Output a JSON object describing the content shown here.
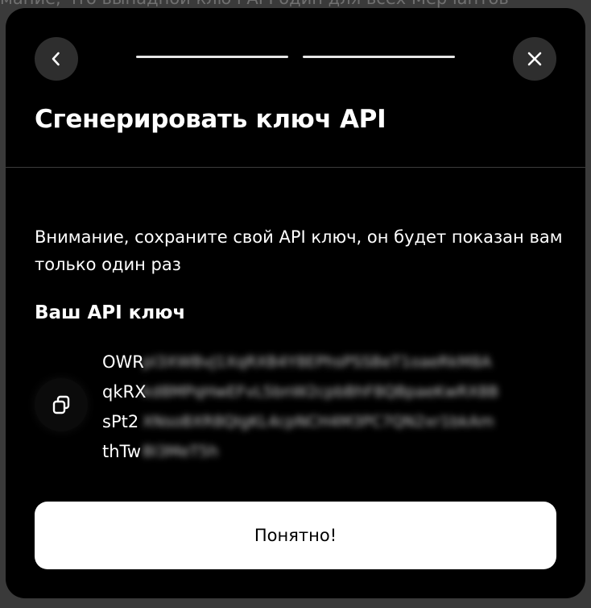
{
  "backdrop": {
    "text": "мание, что выпадной ключ API один для всех Мерчантов"
  },
  "modal": {
    "title": "Сгенерировать ключ API",
    "progress_steps": 2,
    "back_icon": "chevron-left-icon",
    "close_icon": "close-icon",
    "warning": "Внимание, сохраните свой API ключ, он будет показан вам только один раз",
    "key_heading": "Ваш API ключ",
    "copy_icon": "copy-icon",
    "key_lines": [
      {
        "visible": "OWR",
        "hidden": "pl3XWBvJ1XqRXB4Y8EPhsPSSBeT1oaeRkM8A"
      },
      {
        "visible": "qkRX",
        "hidden": "kd8MPqHwEFvL5bnW2cpbBhF8QBpaeKwRX8B"
      },
      {
        "visible": "sPt2",
        "hidden": "XNsoBXR8QIgKL4cpNCH4M3PC7QN2xr1bkAm"
      },
      {
        "visible": "thTw",
        "hidden": "Bl3MeT5h"
      }
    ],
    "confirm_label": "Понятно!"
  },
  "colors": {
    "modal_bg": "#000000",
    "button_bg": "#ffffff",
    "round_btn_bg": "#2e2e2e"
  }
}
